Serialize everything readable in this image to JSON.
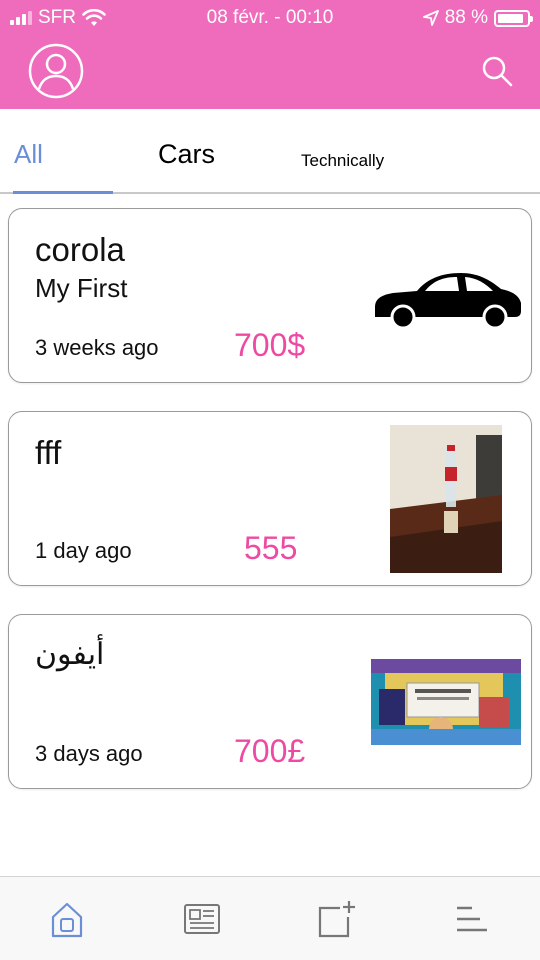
{
  "status_bar": {
    "carrier": "SFR",
    "datetime": "08 févr. - 00:10",
    "battery": "88 %",
    "battery_level": 0.88
  },
  "app_bar": {
    "left_icon": "user-icon",
    "right_icon": "search-icon",
    "color": "#ef6bbc"
  },
  "tabs": [
    {
      "label": "All",
      "active": true
    },
    {
      "label": "Cars",
      "active": false
    },
    {
      "label": "Technically",
      "active": false
    }
  ],
  "listings": [
    {
      "title": "corola",
      "subtitle": "My First",
      "date": "3 weeks ago",
      "price": "700$",
      "image": "car-silhouette"
    },
    {
      "title": "fff",
      "subtitle": "",
      "date": "1 day ago",
      "price": "555",
      "image": "bottle-photo"
    },
    {
      "title": "أيفون",
      "subtitle": "",
      "date": "3 days ago",
      "price": "700£",
      "image": "game-screenshot"
    }
  ],
  "bottom_nav": [
    {
      "icon": "home-icon",
      "active": true
    },
    {
      "icon": "news-icon",
      "active": false
    },
    {
      "icon": "add-post-icon",
      "active": false
    },
    {
      "icon": "menu-icon",
      "active": false
    }
  ],
  "colors": {
    "accent": "#ef6bbc",
    "price": "#ef4aa3",
    "active_tab": "#6a8fd8"
  }
}
